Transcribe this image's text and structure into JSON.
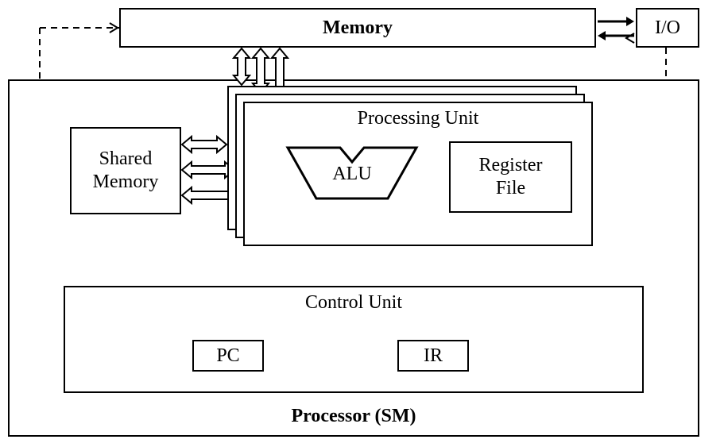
{
  "diagram": {
    "memory": "Memory",
    "io": "I/O",
    "processor": "Processor (SM)",
    "shared_memory": "Shared\nMemory",
    "processing_unit": "Processing Unit",
    "alu": "ALU",
    "register_file": "Register\nFile",
    "control_unit": "Control Unit",
    "pc": "PC",
    "ir": "IR"
  }
}
